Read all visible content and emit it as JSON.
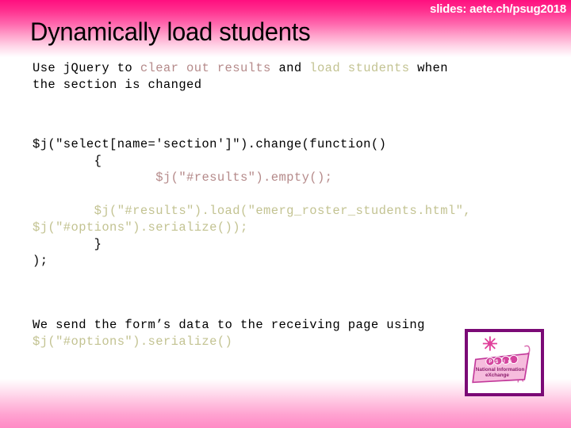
{
  "slide": {
    "header_note": "slides: aete.ch/psug2018",
    "title": "Dynamically load students",
    "intro_parts": {
      "p1": "Use jQuery to ",
      "p2": "clear out results",
      "p3": " and ",
      "p4": "load students",
      "p5": " when\nthe section is changed"
    },
    "code_lines": {
      "l1": "$j(\"select[name='section']\").change(function()",
      "l2": "        {",
      "l3": "                $j(\"#results\").empty();",
      "l4": "",
      "l5": "        $j(\"#results\").load(\"emerg_roster_students.html\",",
      "l6": "$j(\"#options\").serialize());",
      "l7": "        }",
      "l8": ");"
    },
    "outro_parts": {
      "p1": "We send the form’s data to the receiving page using\n",
      "p2": "$j(\"#options\").serialize()"
    },
    "logo": {
      "brand": "PSUG",
      "tagline_line1": "National Information",
      "tagline_line2": "eXchange"
    },
    "colors": {
      "band_pink": "#ff0f7f",
      "rose_text": "#b58a8a",
      "olive_text": "#c3c392",
      "logo_border": "#7b0a76",
      "title_black": "#000000",
      "header_white": "#ffffff"
    }
  }
}
